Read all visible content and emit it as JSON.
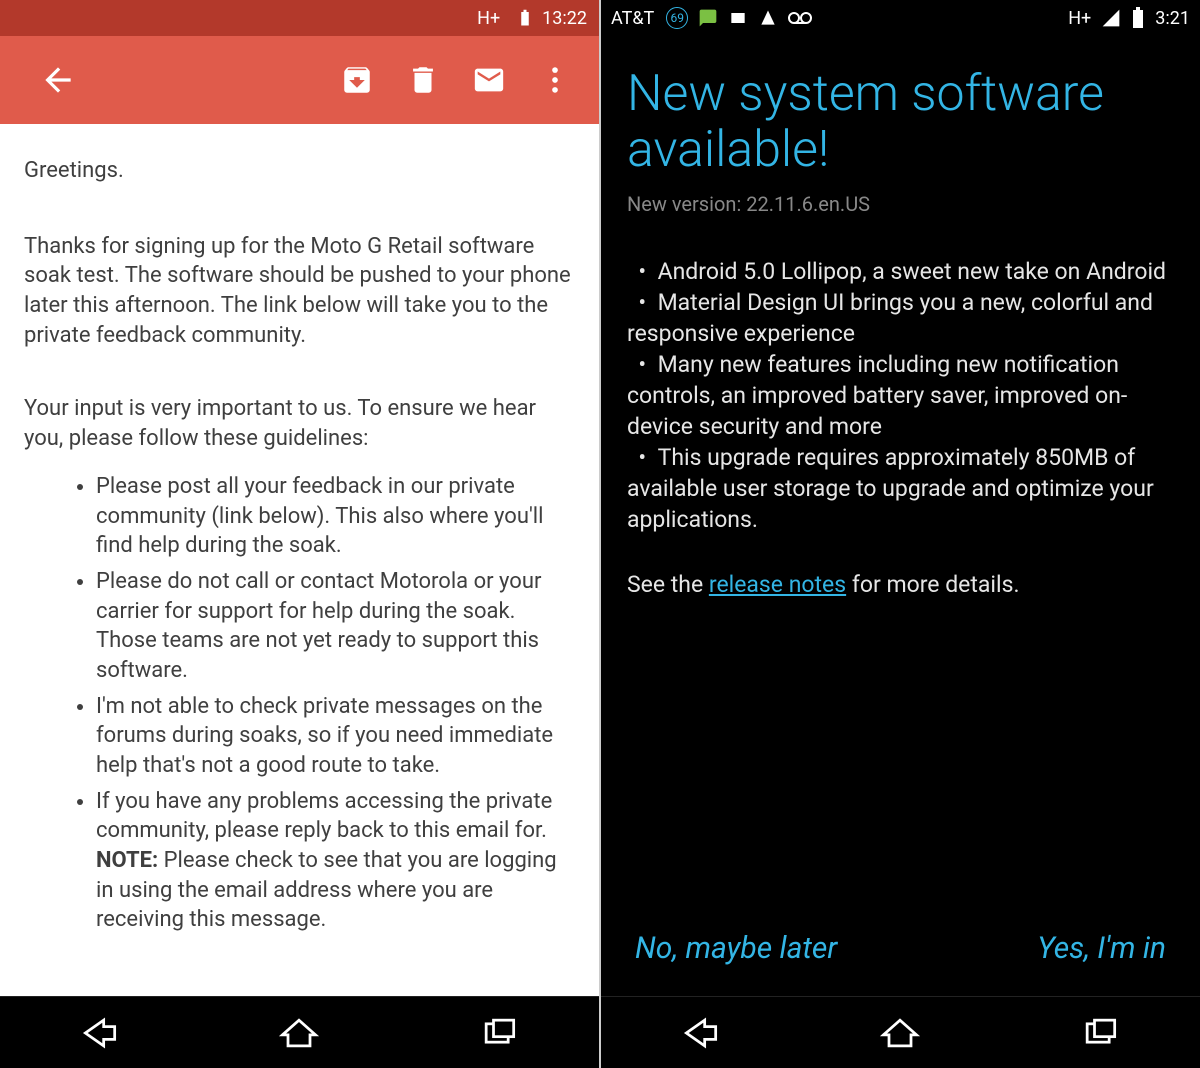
{
  "left": {
    "status": {
      "net": "H+",
      "time": "13:22"
    },
    "email": {
      "greeting": "Greetings.",
      "para1": "Thanks for signing up for the Moto G Retail software soak test. The software should be pushed to your phone later this afternoon. The link below will take you to the private feedback community.",
      "para2": "Your input is very important to us. To ensure we hear you, please follow these guidelines:",
      "bullets": [
        "Please post all your feedback in our private community (link below). This also where you'll find help during the soak.",
        "Please do not call or contact Motorola or your carrier for support for help during the soak. Those teams are not yet ready to support this software.",
        "I'm not able to check private messages on the forums during soaks, so if you need immediate help that's not a good route to take.",
        "If you have any problems accessing the private community, please reply back to this email for. "
      ],
      "bullet4_note_label": "NOTE:",
      "bullet4_note_rest": " Please check to see that you are logging in using the email address where you are receiving this message."
    }
  },
  "right": {
    "status": {
      "carrier": "AT&T",
      "badge": "69",
      "net": "H+",
      "time": "3:21"
    },
    "update": {
      "title": "New system software available!",
      "version_label": "New version: 22.11.6.en.US",
      "bullets": [
        "Android 5.0 Lollipop, a sweet new take on Android",
        "Material Design UI brings you a new, colorful and responsive experience",
        "Many new features including new notification controls, an improved battery saver, improved on-device security and more",
        "This upgrade requires approximately 850MB of available user storage to upgrade and optimize your applications."
      ],
      "see_pre": "See the ",
      "see_link": "release notes",
      "see_post": " for more details.",
      "btn_no": "No, maybe later",
      "btn_yes": "Yes, I'm in"
    }
  }
}
